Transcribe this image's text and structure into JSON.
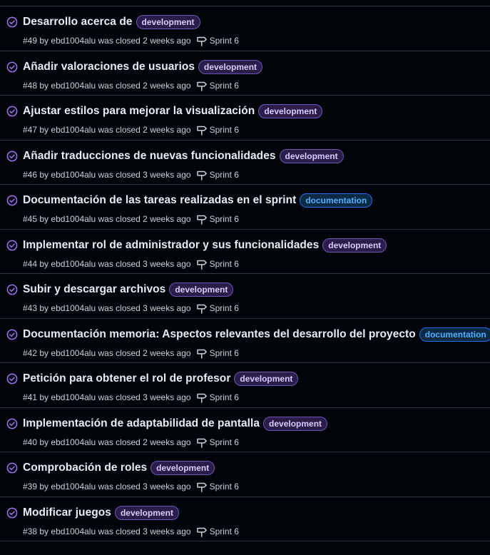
{
  "issues": [
    {
      "title": "Desarrollo acerca de",
      "label": "development",
      "label_type": "development",
      "number": "#49",
      "by": "by",
      "author": "ebd1004alu",
      "status_text": "was closed 2 weeks ago",
      "milestone": "Sprint 6"
    },
    {
      "title": "Añadir valoraciones de usuarios",
      "label": "development",
      "label_type": "development",
      "number": "#48",
      "by": "by",
      "author": "ebd1004alu",
      "status_text": "was closed 2 weeks ago",
      "milestone": "Sprint 6"
    },
    {
      "title": "Ajustar estilos para mejorar la visualización",
      "label": "development",
      "label_type": "development",
      "number": "#47",
      "by": "by",
      "author": "ebd1004alu",
      "status_text": "was closed 2 weeks ago",
      "milestone": "Sprint 6"
    },
    {
      "title": "Añadir traducciones de nuevas funcionalidades",
      "label": "development",
      "label_type": "development",
      "number": "#46",
      "by": "by",
      "author": "ebd1004alu",
      "status_text": "was closed 3 weeks ago",
      "milestone": "Sprint 6"
    },
    {
      "title": "Documentación de las tareas realizadas en el sprint",
      "label": "documentation",
      "label_type": "documentation",
      "number": "#45",
      "by": "by",
      "author": "ebd1004alu",
      "status_text": "was closed 2 weeks ago",
      "milestone": "Sprint 6"
    },
    {
      "title": "Implementar rol de administrador y sus funcionalidades",
      "label": "development",
      "label_type": "development",
      "number": "#44",
      "by": "by",
      "author": "ebd1004alu",
      "status_text": "was closed 3 weeks ago",
      "milestone": "Sprint 6"
    },
    {
      "title": "Subir y descargar archivos",
      "label": "development",
      "label_type": "development",
      "number": "#43",
      "by": "by",
      "author": "ebd1004alu",
      "status_text": "was closed 3 weeks ago",
      "milestone": "Sprint 6"
    },
    {
      "title": "Documentación memoria: Aspectos relevantes del desarrollo del proyecto",
      "label": "documentation",
      "label_type": "documentation",
      "number": "#42",
      "by": "by",
      "author": "ebd1004alu",
      "status_text": "was closed 2 weeks ago",
      "milestone": "Sprint 6"
    },
    {
      "title": "Petición para obtener el rol de profesor",
      "label": "development",
      "label_type": "development",
      "number": "#41",
      "by": "by",
      "author": "ebd1004alu",
      "status_text": "was closed 3 weeks ago",
      "milestone": "Sprint 6"
    },
    {
      "title": "Implementación de adaptabilidad de pantalla",
      "label": "development",
      "label_type": "development",
      "number": "#40",
      "by": "by",
      "author": "ebd1004alu",
      "status_text": "was closed 2 weeks ago",
      "milestone": "Sprint 6"
    },
    {
      "title": "Comprobación de roles",
      "label": "development",
      "label_type": "development",
      "number": "#39",
      "by": "by",
      "author": "ebd1004alu",
      "status_text": "was closed 3 weeks ago",
      "milestone": "Sprint 6"
    },
    {
      "title": "Modificar juegos",
      "label": "development",
      "label_type": "development",
      "number": "#38",
      "by": "by",
      "author": "ebd1004alu",
      "status_text": "was closed 3 weeks ago",
      "milestone": "Sprint 6"
    }
  ],
  "icons": {
    "status": "issue-closed-check-icon",
    "milestone": "milestone-icon"
  },
  "colors": {
    "background": "#010409",
    "divider": "#30363d",
    "closed_icon": "#a371f7",
    "development_label": "#6e56b8",
    "documentation_label": "#1f6feb"
  }
}
